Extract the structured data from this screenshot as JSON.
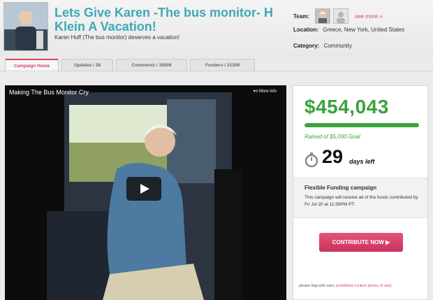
{
  "campaign": {
    "title": "Lets Give Karen -The bus monitor- H Klein A Vacation!",
    "subtitle": "Karen Huff (The bus monitor) deserves a vacation!"
  },
  "meta": {
    "team_label": "Team:",
    "see_more": "see more »",
    "location_label": "Location:",
    "location_value": "Greece, New York, United States",
    "category_label": "Category:",
    "category_value": "Community"
  },
  "tabs": [
    {
      "label": "Campaign Home",
      "active": true
    },
    {
      "label": "Updates / 38"
    },
    {
      "label": "Comments / 18508"
    },
    {
      "label": "Funders / 21309"
    }
  ],
  "video": {
    "title": "Making The Bus Monitor Cry",
    "more_info": "More info"
  },
  "funding": {
    "amount": "$454,043",
    "goal_text": "Raised of $5,000 Goal",
    "progress_fraction": 1.0,
    "days_left_number": "29",
    "days_left_label": "days left",
    "type_title": "Flexible Funding campaign",
    "type_desc": "This campaign will receive all of the funds contributed by Fri Jul 20 at 11:59PM PT.",
    "contribute_label": "CONTRIBUTE NOW ▶"
  },
  "footer": {
    "flag_prefix": "please flag with care:",
    "prohibited_link": "prohibited content",
    "terms_link": "terms of use"
  },
  "colors": {
    "accent_pink": "#d9406a",
    "title_teal": "#3fa9b5",
    "money_green": "#3aa339"
  }
}
